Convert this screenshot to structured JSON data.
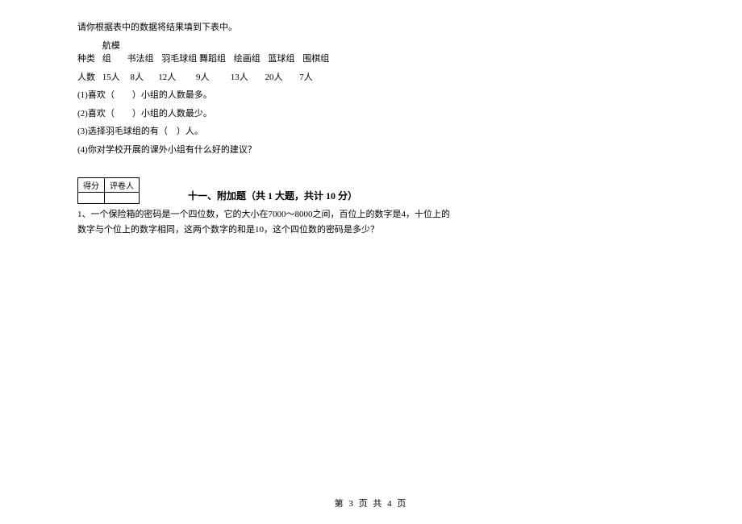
{
  "intro": "请你根据表中的数据将结果填到下表中。",
  "table": {
    "header_label": "种类",
    "headers": [
      "航模组",
      "书法组",
      "羽毛球组",
      "舞蹈组",
      "绘画组",
      "篮球组",
      "围棋组"
    ],
    "count_label": "人数",
    "counts": [
      "15人",
      "8人",
      "12人",
      "9人",
      "13人",
      "20人",
      "7人"
    ]
  },
  "questions": {
    "q1": "(1)喜欢（　　）小组的人数最多。",
    "q2": "(2)喜欢（　　）小组的人数最少。",
    "q3": "(3)选择羽毛球组的有（　）人。",
    "q4": "(4)你对学校开展的课外小组有什么好的建议？"
  },
  "score_box": {
    "score_label": "得分",
    "reviewer_label": "评卷人"
  },
  "section11": {
    "title": "十一、附加题（共 1 大题，共计 10 分）",
    "problem_prefix": "1、",
    "problem_line1": "一个保险箱的密码是一个四位数，它的大小在7000～8000之间，百位上的数字是4，十位上的",
    "problem_line2": "数字与个位上的数字相同，这两个数字的和是10，这个四位数的密码是多少？"
  },
  "footer": "第 3 页 共 4 页"
}
